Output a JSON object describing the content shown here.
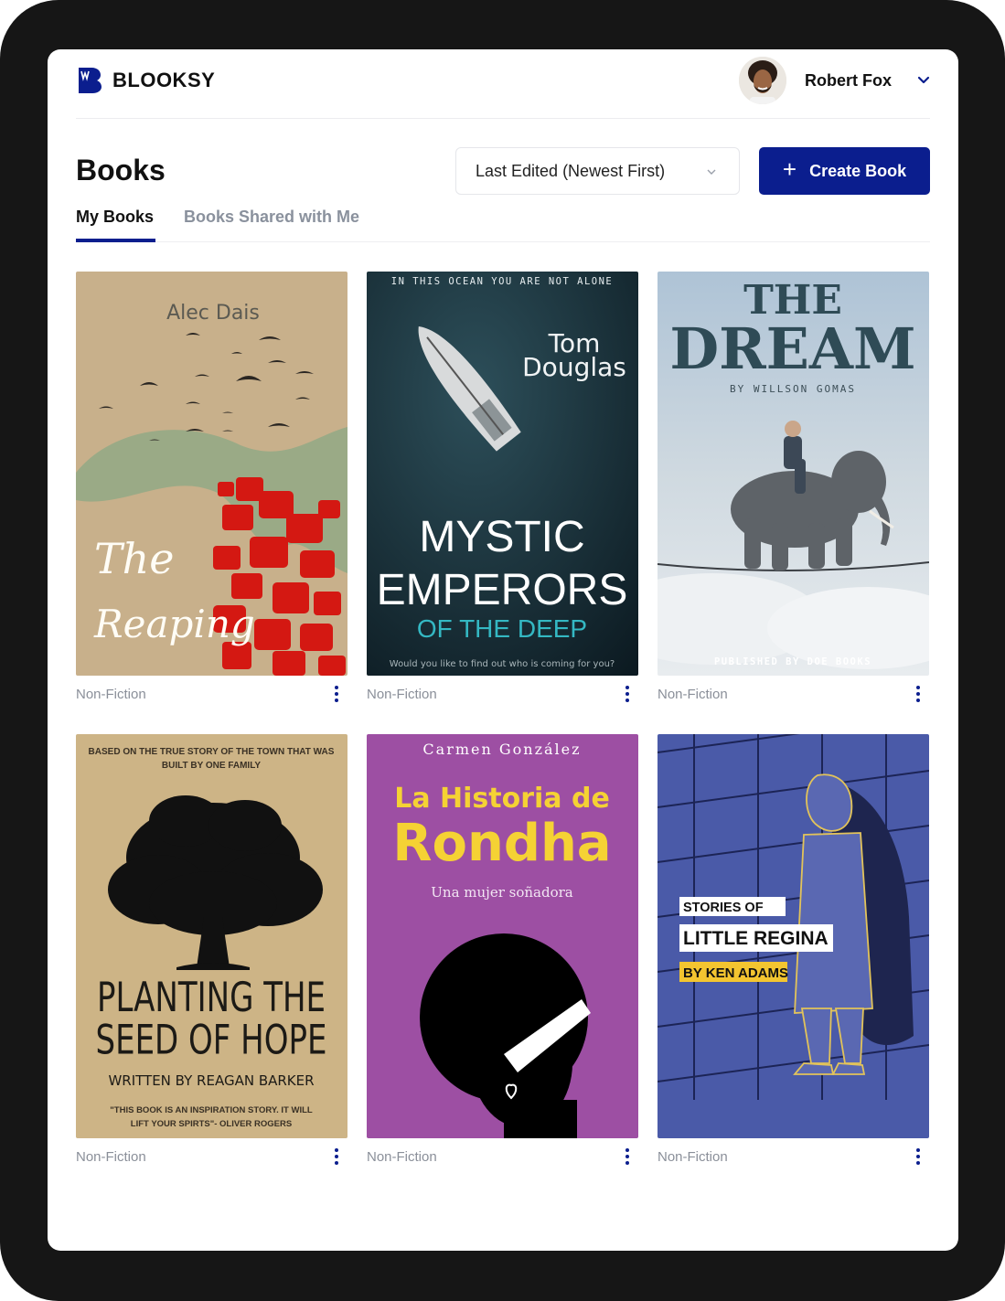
{
  "app": {
    "name": "BLOOKSY"
  },
  "user": {
    "name": "Robert Fox"
  },
  "page": {
    "title": "Books"
  },
  "sort": {
    "selected": "Last Edited (Newest First)"
  },
  "actions": {
    "create_label": "Create Book",
    "create_icon": "plus-icon"
  },
  "tabs": [
    {
      "label": "My Books",
      "active": true
    },
    {
      "label": "Books Shared with Me",
      "active": false
    }
  ],
  "colors": {
    "brand": "#0b1e8e",
    "muted_text": "#8a919d"
  },
  "books": [
    {
      "category": "Non-Fiction",
      "cover": {
        "author": "Alec Dais",
        "title_line1": "The",
        "title_line2": "Reaping"
      }
    },
    {
      "category": "Non-Fiction",
      "cover": {
        "tagline": "IN THIS OCEAN YOU ARE NOT ALONE",
        "author_line1": "Tom",
        "author_line2": "Douglas",
        "title_line1": "MYSTIC",
        "title_line2": "EMPERORS",
        "title_line3": "OF THE DEEP",
        "footer": "Would you like to find out who is coming for you?"
      }
    },
    {
      "category": "Non-Fiction",
      "cover": {
        "title_line1": "THE",
        "title_line2": "DREAM",
        "byline": "BY WILLSON GOMAS",
        "footer": "PUBLISHED BY DOE BOOKS"
      }
    },
    {
      "category": "Non-Fiction",
      "cover": {
        "tagline_line1": "BASED ON THE TRUE STORY OF THE TOWN THAT WAS",
        "tagline_line2": "BUILT BY ONE FAMILY",
        "title_line1": "PLANTING THE",
        "title_line2": "SEED OF HOPE",
        "byline": "WRITTEN BY REAGAN BARKER",
        "quote_line1": "\"THIS BOOK IS AN INSPIRATION STORY. IT WILL",
        "quote_line2": "LIFT YOUR SPIRTS\"- OLIVER ROGERS"
      }
    },
    {
      "category": "Non-Fiction",
      "cover": {
        "author": "Carmen González",
        "title_line1": "La Historia de",
        "title_line2": "Rondha",
        "subtitle": "Una mujer soñadora"
      }
    },
    {
      "category": "Non-Fiction",
      "cover": {
        "line1": "STORIES OF",
        "line2": "LITTLE REGINA",
        "line3": "BY KEN ADAMS"
      }
    }
  ]
}
